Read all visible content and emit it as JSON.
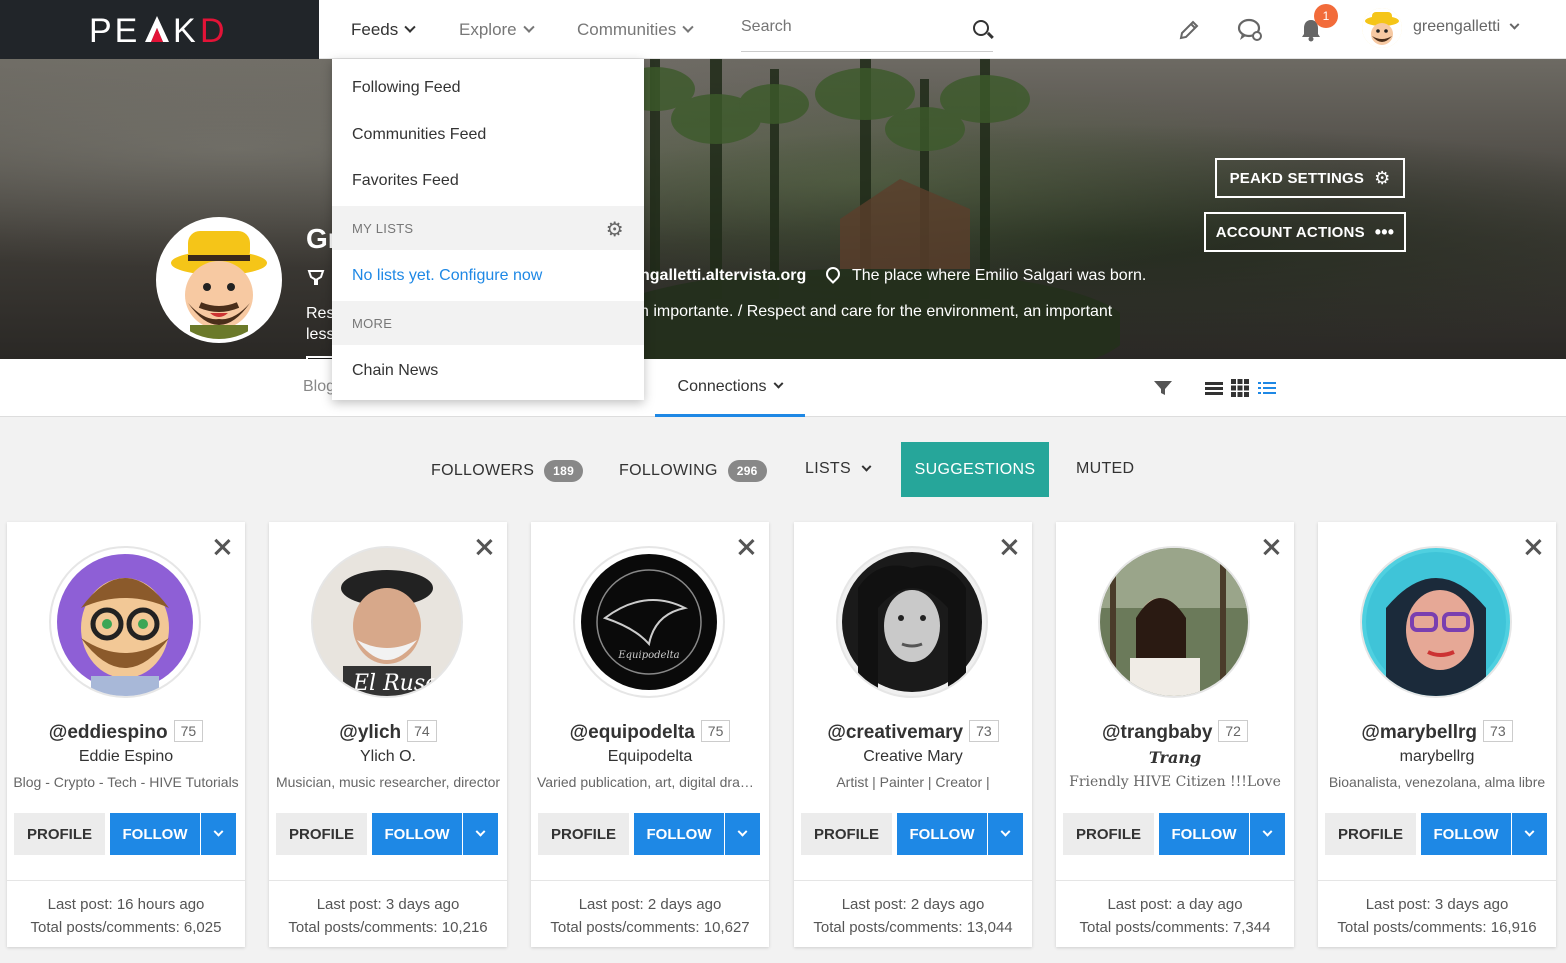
{
  "brand": {
    "logo_text": "PEAKD"
  },
  "topnav": {
    "feeds": "Feeds",
    "explore": "Explore",
    "communities": "Communities",
    "search_placeholder": "Search",
    "notification_count": "1",
    "username": "greengalletti"
  },
  "feeds_menu": {
    "items": [
      "Following Feed",
      "Communities Feed",
      "Favorites Feed"
    ],
    "my_lists_header": "MY LISTS",
    "no_lists_link": "No lists yet. Configure now",
    "more_header": "MORE",
    "more_items": [
      "Chain News"
    ]
  },
  "profile": {
    "name_partial": "Gr",
    "website": "ngalletti.altervista.org",
    "location": "The place where Emilio Salgari was born.",
    "about_left": "Res",
    "about_left_2": "less",
    "about": "n importante. / Respect and care for the environment, an important",
    "settings_button": "PEAKD SETTINGS",
    "account_actions_button": "ACCOUNT ACTIONS"
  },
  "profile_nav": {
    "blog": "Blog",
    "connections": "Connections"
  },
  "connection_tabs": {
    "followers": "FOLLOWERS",
    "followers_count": "189",
    "following": "FOLLOWING",
    "following_count": "296",
    "lists": "LISTS",
    "suggestions": "SUGGESTIONS",
    "muted": "MUTED"
  },
  "card_labels": {
    "profile": "PROFILE",
    "follow": "FOLLOW"
  },
  "suggestions": [
    {
      "handle": "@eddiespino",
      "rep": "75",
      "display_name": "Eddie Espino",
      "bio": "Blog - Crypto - Tech - HIVE Tutorials",
      "last_post": "Last post: 16 hours ago",
      "total": "Total posts/comments: 6,025"
    },
    {
      "handle": "@ylich",
      "rep": "74",
      "display_name": "Ylich O.",
      "bio": "Musician, music researcher, director",
      "last_post": "Last post: 3 days ago",
      "total": "Total posts/comments: 10,216"
    },
    {
      "handle": "@equipodelta",
      "rep": "75",
      "display_name": "Equipodelta",
      "bio": "Varied publication, art, digital drawing",
      "last_post": "Last post: 2 days ago",
      "total": "Total posts/comments: 10,627"
    },
    {
      "handle": "@creativemary",
      "rep": "73",
      "display_name": "Creative Mary",
      "bio": "Artist | Painter | Creator |",
      "last_post": "Last post: 2 days ago",
      "total": "Total posts/comments: 13,044"
    },
    {
      "handle": "@trangbaby",
      "rep": "72",
      "display_name": "Trang",
      "bio": "Friendly HIVE Citizen !!!Love",
      "last_post": "Last post: a day ago",
      "total": "Total posts/comments: 7,344"
    },
    {
      "handle": "@marybellrg",
      "rep": "73",
      "display_name": "marybellrg",
      "bio": "Bioanalista, venezolana, alma libre",
      "last_post": "Last post: 3 days ago",
      "total": "Total posts/comments: 16,916"
    }
  ],
  "colors": {
    "accent": "#1e88e5",
    "teal": "#26a69a",
    "brand_red": "#e31337",
    "logo_bg": "#212529"
  }
}
